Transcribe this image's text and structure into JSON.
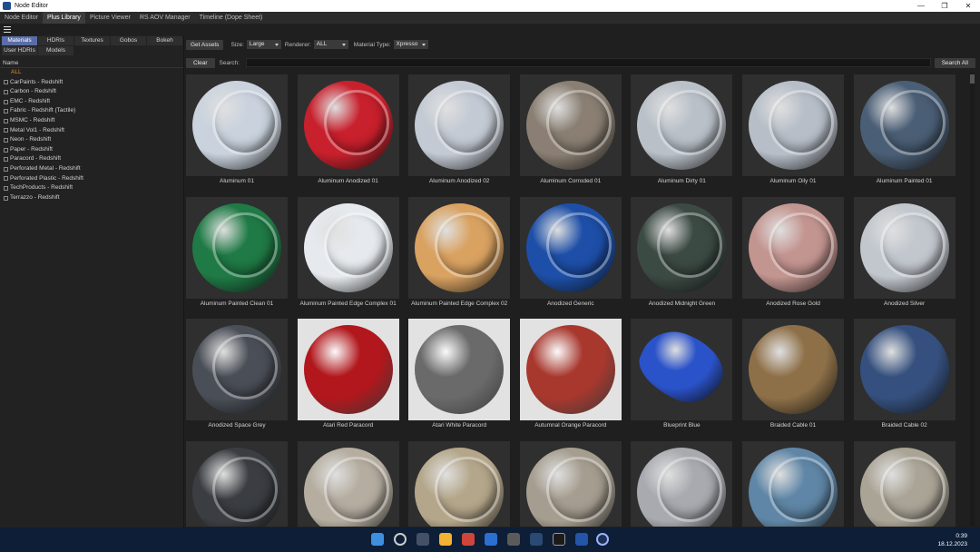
{
  "window": {
    "title": "Node Editor",
    "controls": [
      "minimize",
      "restore",
      "close"
    ]
  },
  "tabs": [
    "Node Editor",
    "Plus Library",
    "Picture Viewer",
    "RS AOV Manager",
    "Timeline (Dope Sheet)"
  ],
  "active_tab": "Plus Library",
  "sidebar": {
    "category_tabs": [
      "Materials",
      "HDRIs",
      "Textures",
      "Gobos",
      "Bokeh"
    ],
    "category_tabs_row2": [
      "User HDRIs",
      "Models"
    ],
    "active_category": "Materials",
    "list_header": "Name",
    "all_label": "ALL",
    "items": [
      "CarPaints - Redshift",
      "Carbon - Redshift",
      "EMC - Redshift",
      "Fabric - Redshift (Tactile)",
      "MSMC - Redshift",
      "Metal Vol1 - Redshift",
      "Neon - Redshift",
      "Paper - Redshift",
      "Paracord - Redshift",
      "Perforated Metal - Redshift",
      "Perforated Plastic - Redshift",
      "TechProducts - Redshift",
      "Terrazzo - Redshift"
    ]
  },
  "toolbar": {
    "get_assets": "Get Assets",
    "size_label": "Size:",
    "size_value": "Large",
    "renderer_label": "Renderer:",
    "renderer_value": "ALL",
    "material_type_label": "Material Type:",
    "material_type_value": "Xpresso"
  },
  "search": {
    "clear_label": "Clear",
    "label": "Search:",
    "value": "",
    "search_all_label": "Search All"
  },
  "materials": [
    {
      "name": "Aluminum 01",
      "color": "#c9d2dd"
    },
    {
      "name": "Aluminum Anodized 01",
      "color": "#c8202c"
    },
    {
      "name": "Aluminum Anodized 02",
      "color": "#c4cad4"
    },
    {
      "name": "Aluminum Corroded 01",
      "color": "#8a7f72"
    },
    {
      "name": "Aluminum Dirty 01",
      "color": "#b9c0c8"
    },
    {
      "name": "Aluminum Oily 01",
      "color": "#b7bec8"
    },
    {
      "name": "Aluminum Painted 01",
      "color": "#4a5e75"
    },
    {
      "name": "Aluminum Painted Clean 01",
      "color": "#1f7a45"
    },
    {
      "name": "Aluminum Painted Edge Complex 01",
      "color": "#e6eaee"
    },
    {
      "name": "Aluminum Painted Edge Complex 02",
      "color": "#d9a261"
    },
    {
      "name": "Anodized Generic",
      "color": "#1d4fa8"
    },
    {
      "name": "Anodized Midnight Green",
      "color": "#3c4a44"
    },
    {
      "name": "Anodized Rose Gold",
      "color": "#c39590"
    },
    {
      "name": "Anodized Silver",
      "color": "#c2c7ce"
    },
    {
      "name": "Anodized Space Grey",
      "color": "#4a4f57"
    },
    {
      "name": "Atari Red Paracord",
      "color": "#b1171c"
    },
    {
      "name": "Atari White Paracord",
      "color": "#6a6a6a"
    },
    {
      "name": "Autumnal Orange Paracord",
      "color": "#a8382e"
    },
    {
      "name": "Blueprint Blue",
      "color": "#2a52c9"
    },
    {
      "name": "Braided Cable 01",
      "color": "#8e7048"
    },
    {
      "name": "Braided Cable 02",
      "color": "#35507e"
    },
    {
      "name": "",
      "color": "#3a3d42"
    },
    {
      "name": "",
      "color": "#b5ada0"
    },
    {
      "name": "",
      "color": "#b4a68a"
    },
    {
      "name": "",
      "color": "#a59d8f"
    },
    {
      "name": "",
      "color": "#a8aab0"
    },
    {
      "name": "",
      "color": "#5f86a6"
    },
    {
      "name": "",
      "color": "#aaa496"
    }
  ],
  "taskbar": {
    "time": "0:39",
    "date": "18.12.2023"
  }
}
